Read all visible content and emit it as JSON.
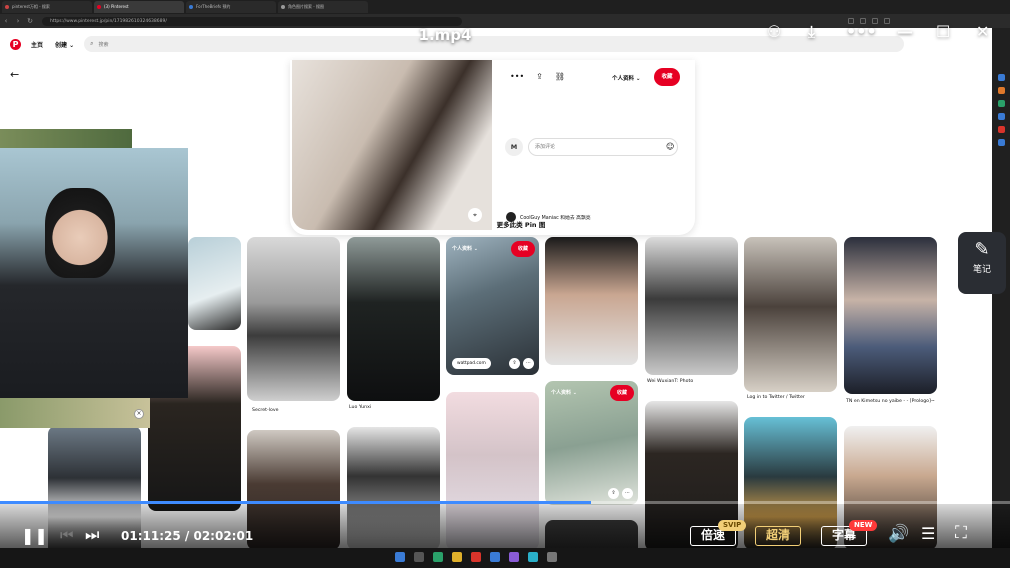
{
  "browser": {
    "tabs": [
      {
        "title": "pinterest万相 - 搜索",
        "color": "#cc4444"
      },
      {
        "title": "(3) Pinterest",
        "color": "#e60023"
      },
      {
        "title": "ForTheBriefs 预约",
        "color": "#3a7bd5"
      },
      {
        "title": "角色图片搜索 - 搜图",
        "color": "#999999"
      }
    ],
    "url": "https://www.pinterest.jp/pin/171982610324638689/"
  },
  "pinterest": {
    "logo": "P",
    "nav_home": "主页",
    "nav_create": "创建 ⌄",
    "search_placeholder": "搜索",
    "pin": {
      "profile_dropdown": "个人资料 ⌄",
      "save_label": "收藏",
      "comment_avatar": "M",
      "comment_placeholder": "添加评论",
      "author": "CoolGuy Maniac 和她去 高飘亮"
    },
    "more_heading": "更多此类 Pin 图",
    "tiles": [
      {
        "caption": "Secret-love"
      },
      {
        "caption": "Luo Yunxi"
      },
      {
        "profile": "个人资料 ⌄",
        "save": "收藏",
        "url": "wattpad.com"
      },
      {
        "caption": ""
      },
      {
        "caption": "Wei WuxianT: Photo"
      },
      {
        "caption": "Log in to Twitter / Twitter"
      },
      {
        "caption": "TN en Kimetsu no yaibe - - [Prologo]~"
      },
      {
        "profile": "个人资料 ⌄",
        "save": "收藏"
      }
    ]
  },
  "player": {
    "title": "1.mp4",
    "time_current": "01:11:25",
    "time_separator": "/",
    "time_total": "02:02:01",
    "progress": 0.585,
    "speed_label": "倍速",
    "speed_badge": "SVIP",
    "quality_label": "超清",
    "subtitle_label": "字幕",
    "subtitle_badge": "NEW",
    "notes_label": "笔记"
  }
}
